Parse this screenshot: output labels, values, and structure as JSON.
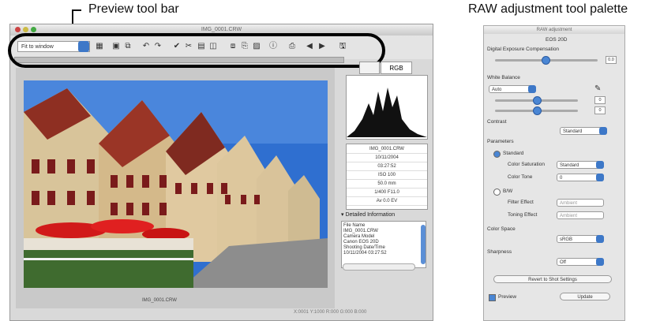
{
  "callouts": {
    "preview_toolbar": "Preview tool bar",
    "raw_palette": "RAW adjustment tool palette"
  },
  "window": {
    "title": "IMG_0001.CRW",
    "fit_select": "Fit to window"
  },
  "tabs": [
    "",
    "RGB"
  ],
  "photo_caption": "IMG_0001.CRW",
  "info": {
    "rows": [
      "IMG_0001.CRW",
      "10/11/2004",
      "03:27:52",
      "ISO 100",
      "50.0 mm",
      "1/400   F11.0",
      "Av   0.0 EV"
    ]
  },
  "detail": {
    "title": "▾ Detailed Information",
    "lines": [
      "File Name",
      "IMG_0001.CRW",
      "Camera Model",
      "Canon EOS 20D",
      "Shooting Date/Time",
      "10/11/2004 03:27:52"
    ]
  },
  "coords": "X:0001 Y:1000   R:000 G:000 B:000",
  "palette": {
    "title": "RAW adjustment",
    "camera": "EOS 20D",
    "dec_label": "Digital Exposure Compensation",
    "dec_value": "0.0",
    "wb_label": "White Balance",
    "wb_select": "Auto",
    "contrast_label": "Contrast",
    "contrast_select": "Standard",
    "parameters_label": "Parameters",
    "standard_label": "Standard",
    "color_sat_label": "Color Saturation",
    "color_sat_select": "Standard",
    "color_tone_label": "Color Tone",
    "color_tone_select": "0",
    "bw_label": "B/W",
    "filter_label": "Filter Effect",
    "filter_select": "Ambient",
    "toning_label": "Toning Effect",
    "toning_select": "Ambient",
    "color_space_label": "Color Space",
    "color_space_select": "sRGB",
    "sharpness_label": "Sharpness",
    "sharpness_select": "Off",
    "reset_button": "Revert to Shot Settings",
    "preview_label": "Preview",
    "update_button": "Update"
  }
}
